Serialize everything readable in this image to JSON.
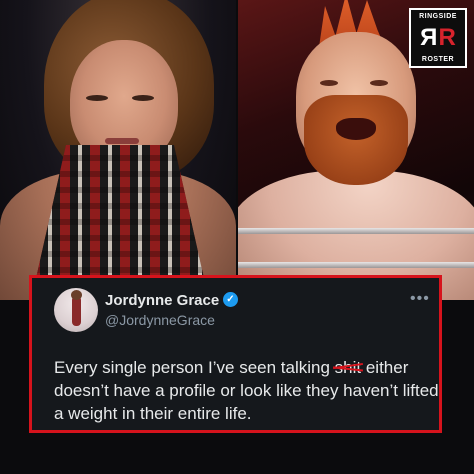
{
  "logo": {
    "top_text": "RINGSIDE",
    "bottom_text": "ROSTER",
    "mark_left": "R",
    "mark_right": "R",
    "accent_color": "#d7232c"
  },
  "tweet": {
    "display_name": "Jordynne Grace",
    "handle": "@JordynneGrace",
    "verified_icon": "verified-badge-icon",
    "more_icon": "more-options-icon",
    "more_glyph": "•••",
    "text_part1": "Every single person I’ve seen talking ",
    "censored_word": "shit",
    "text_part2": " either doesn’t have a profile or look like they haven’t lifted a weight in their entire life.",
    "border_color": "#d6131c"
  }
}
